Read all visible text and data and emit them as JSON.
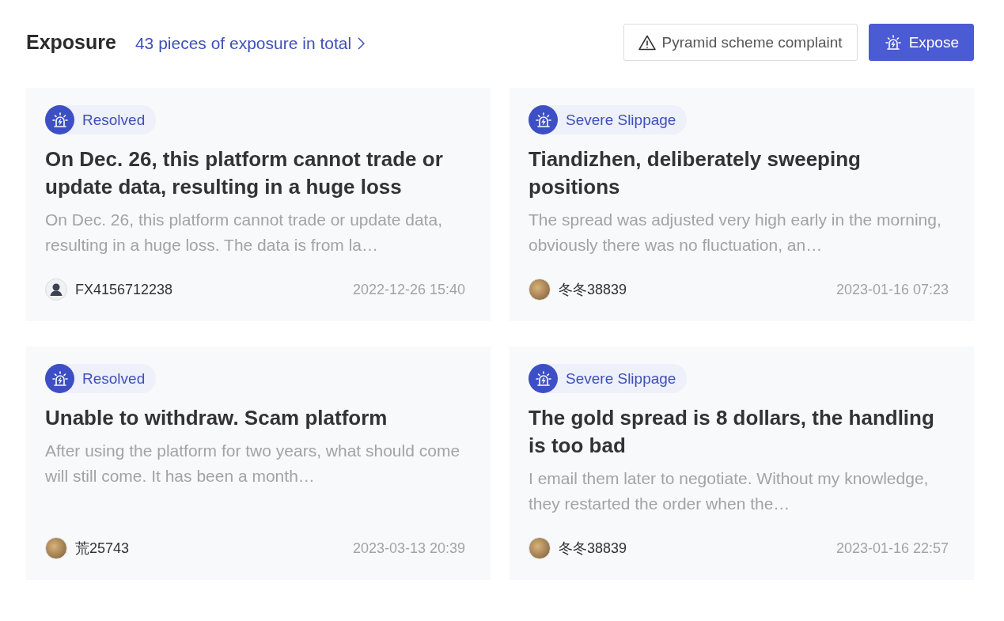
{
  "header": {
    "title": "Exposure",
    "total_link": "43 pieces of exposure in total",
    "complaint_button": "Pyramid scheme complaint",
    "expose_button": "Expose"
  },
  "cards": [
    {
      "tag": "Resolved",
      "title": "On Dec. 26, this platform cannot trade or update data, resulting in a huge loss",
      "description": "On Dec. 26, this platform cannot trade or update data, resulting in a huge loss. The data is from la…",
      "user": "FX4156712238",
      "avatar": {
        "kind": "silhouette"
      },
      "date": "2022-12-26 15:40"
    },
    {
      "tag": "Severe Slippage",
      "title": "Tiandizhen, deliberately sweeping positions",
      "description": "The spread was adjusted very high early in the morning, obviously there was no fluctuation, an…",
      "user": "冬冬38839",
      "avatar": {
        "kind": "photo"
      },
      "date": "2023-01-16 07:23"
    },
    {
      "tag": "Resolved",
      "title": "Unable to withdraw. Scam platform",
      "description": "After using the platform for two years, what should come will still come. It has been a month…",
      "user": "荒25743",
      "avatar": {
        "kind": "photo"
      },
      "date": "2023-03-13 20:39"
    },
    {
      "tag": "Severe Slippage",
      "title": "The gold spread is 8 dollars, the handling is too bad",
      "description": "I email them later to negotiate. Without my knowledge, they restarted the order when the…",
      "user": "冬冬38839",
      "avatar": {
        "kind": "photo"
      },
      "date": "2023-01-16 22:57"
    }
  ]
}
